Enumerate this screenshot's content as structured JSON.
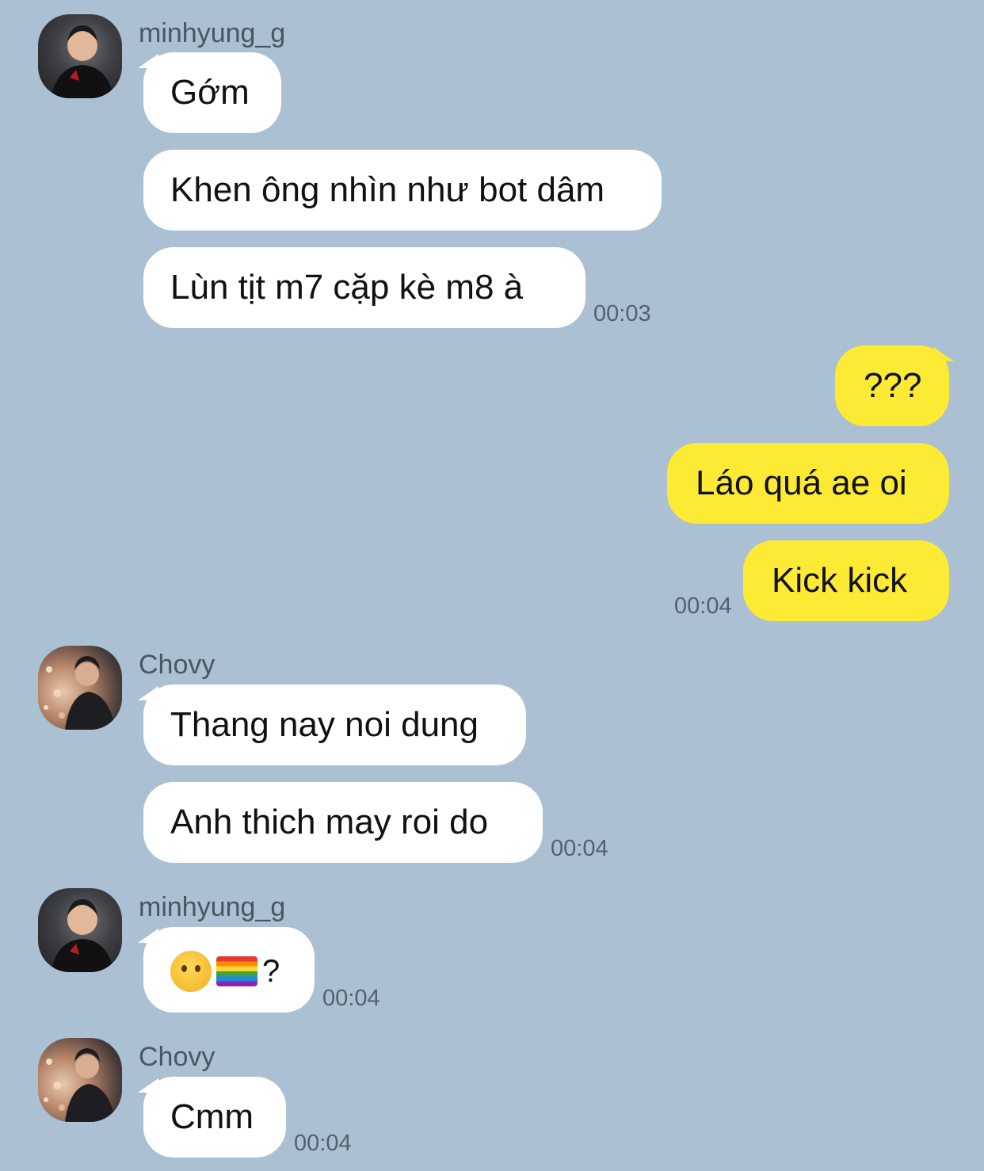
{
  "chat": {
    "background_color": "#abc1d3",
    "incoming_bubble_color": "#ffffff",
    "outgoing_bubble_color": "#fdea35",
    "messages": [
      {
        "sender": "minhyung_g",
        "bubbles": [
          "Gớm",
          "Khen ông nhìn như bot dâm",
          "Lùn tịt m7 cặp kè m8 à"
        ],
        "time": "00:03"
      },
      {
        "sender": "me",
        "bubbles": [
          "???",
          "Láo quá ae oi",
          "Kick kick"
        ],
        "time": "00:04"
      },
      {
        "sender": "Chovy",
        "bubbles": [
          "Thang nay noi dung",
          "Anh thich may roi do"
        ],
        "time": "00:04"
      },
      {
        "sender": "minhyung_g",
        "bubbles": [
          "?"
        ],
        "emoji": [
          "raised-eyebrow-face-icon",
          "rainbow-flag-icon"
        ],
        "time": "00:04"
      },
      {
        "sender": "Chovy",
        "bubbles": [
          "Cmm"
        ],
        "time": "00:04"
      }
    ]
  }
}
